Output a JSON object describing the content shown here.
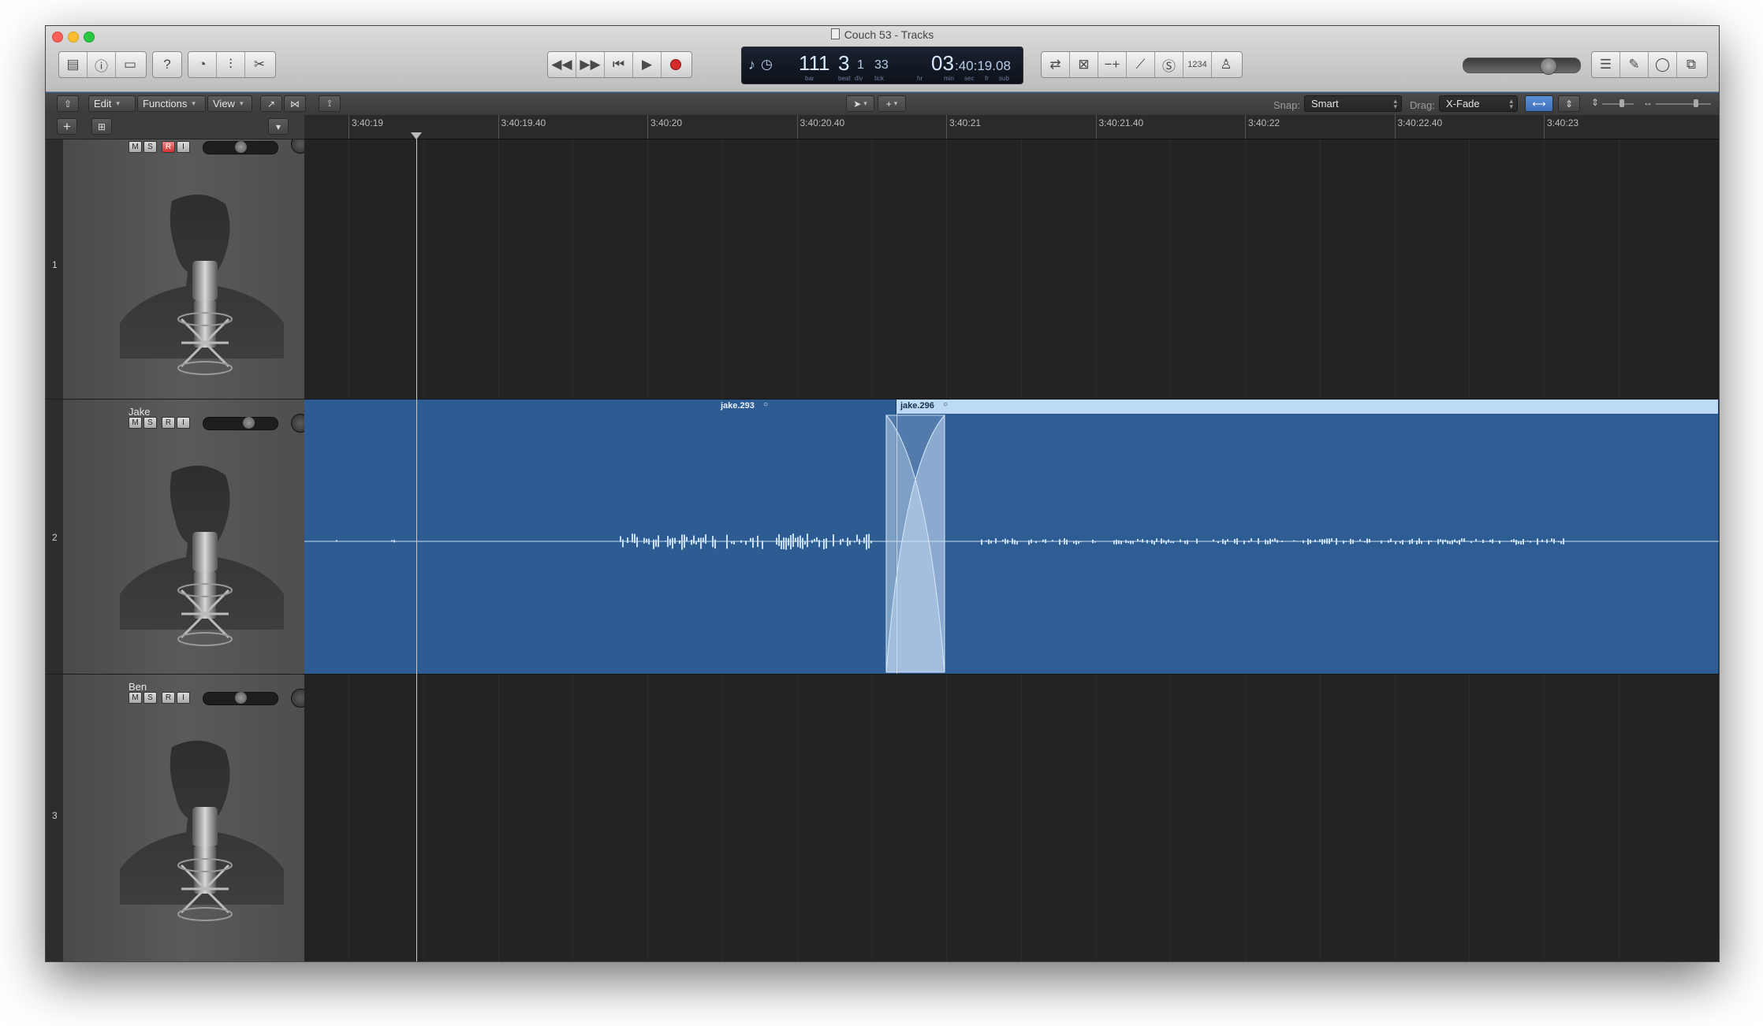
{
  "window": {
    "title": "Couch 53 - Tracks",
    "traffic_lights": {
      "close": "#ff5f57",
      "minimize": "#febc2e",
      "zoom": "#28c840"
    }
  },
  "control_bar": {
    "left_icons": [
      "library-icon",
      "inspector-icon",
      "toolbar-icon",
      "quick-help-icon",
      "smart-controls-icon",
      "mixer-icon",
      "editors-icon"
    ],
    "transport": [
      "rewind-icon",
      "fast-forward-icon",
      "go-to-beginning-icon",
      "play-icon",
      "record-icon"
    ],
    "lcd": {
      "bar": "111",
      "beat": "3",
      "div": "1",
      "tick": "33",
      "hr": "03",
      "time": ":40:19.08",
      "labels": {
        "bar": "bar",
        "beat": "beat",
        "div": "div",
        "tick": "tick",
        "hr": "hr",
        "min": "min",
        "sec": "sec",
        "fr": "fr",
        "sub": "sub"
      }
    },
    "mode_icons": [
      "cycle-icon",
      "replace-icon",
      "autopunch-icon",
      "tuner-icon",
      "solo-icon",
      "count-in-icon",
      "metronome-icon"
    ],
    "count_in_text": "1234",
    "master_volume": 0.68,
    "right_icons": [
      "list-editors-icon",
      "notepad-icon",
      "loop-browser-icon",
      "browsers-icon"
    ]
  },
  "local_bar": {
    "back_icon": "back-arrow-icon",
    "menus": [
      "Edit",
      "Functions",
      "View"
    ],
    "tools": [
      "catch-icon",
      "link-icon",
      "flex-icon"
    ],
    "pointer_tool": "pointer-tool-icon",
    "marquee_tool": "marquee-tool-icon",
    "snap_label": "Snap:",
    "snap_value": "Smart",
    "drag_label": "Drag:",
    "drag_value": "X-Fade",
    "waveform_zoom_icon": "waveform-zoom-icon",
    "vertical_zoom_icon": "vertical-zoom-icon",
    "horizontal_zoom_icon": "horizontal-zoom-icon"
  },
  "header_tools": {
    "add_track": "+",
    "duplicate_track": "duplicate-track-icon",
    "dropdown": "global-tracks-icon"
  },
  "ruler": {
    "labels": [
      "3:40:19",
      "3:40:19.40",
      "3:40:20",
      "3:40:20.40",
      "3:40:21",
      "3:40:21.40",
      "3:40:22",
      "3:40:22.40",
      "3:40:23"
    ]
  },
  "tracks": [
    {
      "number": "1",
      "name": "",
      "buttons": [
        "M",
        "S",
        "R",
        "I"
      ],
      "record_armed": true,
      "volume": 0.38,
      "avatar": "microphone-silhouette-icon"
    },
    {
      "number": "2",
      "name": "Jake",
      "buttons": [
        "M",
        "S",
        "R",
        "I"
      ],
      "record_armed": false,
      "volume": 0.45,
      "avatar": "microphone-silhouette-icon",
      "regions": [
        {
          "name": "jake.293",
          "loop_icon": "region-loop-icon"
        },
        {
          "name": "jake.296",
          "loop_icon": "region-loop-icon",
          "selected": true
        }
      ],
      "crossfade": "X-Fade"
    },
    {
      "number": "3",
      "name": "Ben",
      "buttons": [
        "M",
        "S",
        "R",
        "I"
      ],
      "record_armed": false,
      "volume": 0.38,
      "avatar": "microphone-silhouette-icon"
    }
  ],
  "colors": {
    "region": "#2c5c92",
    "region_selected_bar": "#bcd9f5",
    "waveform": "#c9def2",
    "record": "#d42a2a"
  }
}
